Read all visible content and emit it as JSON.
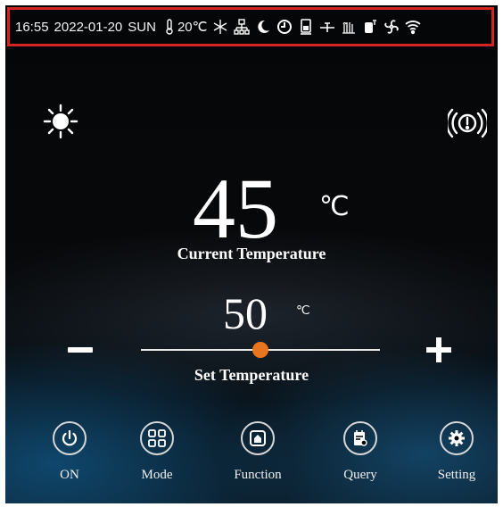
{
  "status": {
    "time": "16:55",
    "date": "2022-01-20",
    "weekday": "SUN",
    "ambient_temp": "20℃",
    "icons": [
      "thermometer-icon",
      "defrost-icon",
      "network-icon",
      "night-mode-icon",
      "timer-icon",
      "tank-icon",
      "valve-icon",
      "heater-icon",
      "compressor-icon",
      "fan-icon",
      "wifi-icon"
    ]
  },
  "main": {
    "current_temp": "45",
    "current_unit": "℃",
    "current_label": "Current Temperature",
    "set_temp": "50",
    "set_unit": "℃",
    "set_label": "Set Temperature",
    "slider_fraction": 0.5,
    "accent_color": "#e8761e"
  },
  "buttons": [
    {
      "label": "ON",
      "icon": "power-icon"
    },
    {
      "label": "Mode",
      "icon": "grid-icon"
    },
    {
      "label": "Function",
      "icon": "home-icon"
    },
    {
      "label": "Query",
      "icon": "calendar-search-icon"
    },
    {
      "label": "Setting",
      "icon": "gear-icon"
    }
  ]
}
